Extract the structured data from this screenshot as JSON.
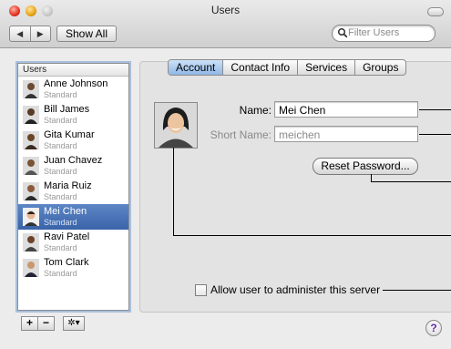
{
  "window": {
    "title": "Users"
  },
  "toolbar": {
    "back_glyph": "◀",
    "forward_glyph": "▶",
    "show_all_label": "Show All",
    "filter_placeholder": "Filter Users",
    "filter_value": ""
  },
  "users_list": {
    "header": "Users",
    "items": [
      {
        "name": "Anne Johnson",
        "role": "Standard",
        "selected": false
      },
      {
        "name": "Bill James",
        "role": "Standard",
        "selected": false
      },
      {
        "name": "Gita Kumar",
        "role": "Standard",
        "selected": false
      },
      {
        "name": "Juan Chavez",
        "role": "Standard",
        "selected": false
      },
      {
        "name": "Maria Ruiz",
        "role": "Standard",
        "selected": false
      },
      {
        "name": "Mei Chen",
        "role": "Standard",
        "selected": true
      },
      {
        "name": "Ravi Patel",
        "role": "Standard",
        "selected": false
      },
      {
        "name": "Tom Clark",
        "role": "Standard",
        "selected": false
      }
    ]
  },
  "list_buttons": {
    "add": "+",
    "remove": "−",
    "action": "✲▾"
  },
  "tabs": [
    {
      "label": "Account",
      "active": true
    },
    {
      "label": "Contact Info",
      "active": false
    },
    {
      "label": "Services",
      "active": false
    },
    {
      "label": "Groups",
      "active": false
    }
  ],
  "account": {
    "name_label": "Name:",
    "name_value": "Mei Chen",
    "short_name_label": "Short Name:",
    "short_name_value": "meichen",
    "reset_password_label": "Reset Password...",
    "admin_checkbox_label": "Allow user to administer this server",
    "admin_checked": false
  },
  "help_label": "?",
  "colors": {
    "selection": "#3f6cb2",
    "focus_ring": "#a9c0dd",
    "active_tab": "#a9c9ef"
  }
}
